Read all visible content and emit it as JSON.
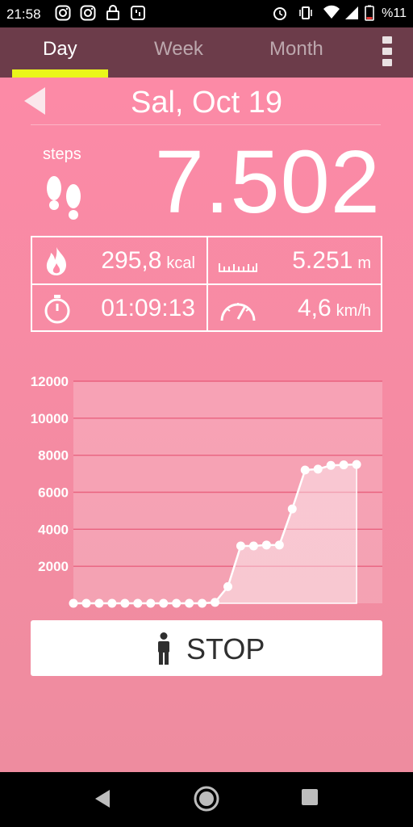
{
  "status": {
    "time": "21:58",
    "battery_text": "%11",
    "left_icons": [
      "instagram-icon",
      "instagram-icon",
      "lock-icon",
      "app-icon"
    ],
    "right_icons": [
      "alarm-icon",
      "vibrate-icon",
      "wifi-icon",
      "signal-icon",
      "battery-icon"
    ]
  },
  "tabs": [
    {
      "label": "Day",
      "active": true
    },
    {
      "label": "Week",
      "active": false
    },
    {
      "label": "Month",
      "active": false
    }
  ],
  "date": "Sal, Oct 19",
  "steps": {
    "label": "steps",
    "value": "7.502"
  },
  "stats": {
    "calories": {
      "value": "295,8",
      "unit": "kcal"
    },
    "distance": {
      "value": "5.251",
      "unit": "m"
    },
    "duration": {
      "value": "01:09:13"
    },
    "speed": {
      "value": "4,6",
      "unit": "km/h"
    }
  },
  "stop_button": {
    "label": "STOP"
  },
  "colors": {
    "tabbar": "#6c3c4a",
    "tab_indicator": "#eaf61a",
    "background": "#fd8aa7"
  },
  "chart_data": {
    "type": "line",
    "x": [
      0,
      1,
      2,
      3,
      4,
      5,
      6,
      7,
      8,
      9,
      10,
      11,
      12,
      13,
      14,
      15,
      16,
      17,
      18,
      19,
      20,
      21,
      22
    ],
    "y": [
      0,
      0,
      0,
      0,
      0,
      0,
      0,
      0,
      0,
      0,
      0,
      50,
      900,
      3100,
      3100,
      3150,
      3150,
      5100,
      7200,
      7250,
      7450,
      7480,
      7502
    ],
    "xticks": [
      2,
      4,
      6,
      8,
      10,
      12,
      14,
      16,
      18,
      20,
      22,
      24
    ],
    "yticks": [
      2000,
      4000,
      6000,
      8000,
      10000,
      12000
    ],
    "xlim": [
      0,
      24
    ],
    "ylim": [
      0,
      12000
    ],
    "grid": true
  }
}
